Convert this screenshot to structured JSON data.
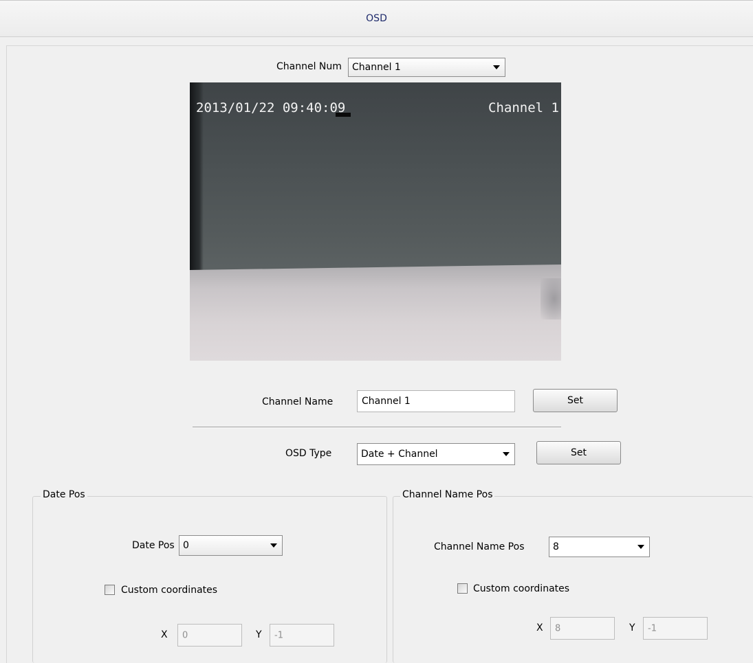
{
  "header": {
    "title": "OSD"
  },
  "channel_num": {
    "label": "Channel Num",
    "selected": "Channel  1"
  },
  "preview": {
    "osd_datetime": "2013/01/22 09:40:09",
    "osd_channel": "Channel 1"
  },
  "channel_name": {
    "label": "Channel Name",
    "value": "Channel 1",
    "set_label": "Set"
  },
  "osd_type": {
    "label": "OSD Type",
    "selected": "Date + Channel",
    "set_label": "Set"
  },
  "date_pos_group": {
    "title": "Date Pos",
    "pos_label": "Date Pos",
    "pos_value": "0",
    "custom_label": "Custom coordinates",
    "custom_checked": false,
    "x_label": "X",
    "x_value": "0",
    "y_label": "Y",
    "y_value": "-1"
  },
  "channel_name_pos_group": {
    "title": "Channel Name Pos",
    "pos_label": "Channel Name Pos",
    "pos_value": "8",
    "custom_label": "Custom coordinates",
    "custom_checked": false,
    "x_label": "X",
    "x_value": "8",
    "y_label": "Y",
    "y_value": "-1"
  }
}
